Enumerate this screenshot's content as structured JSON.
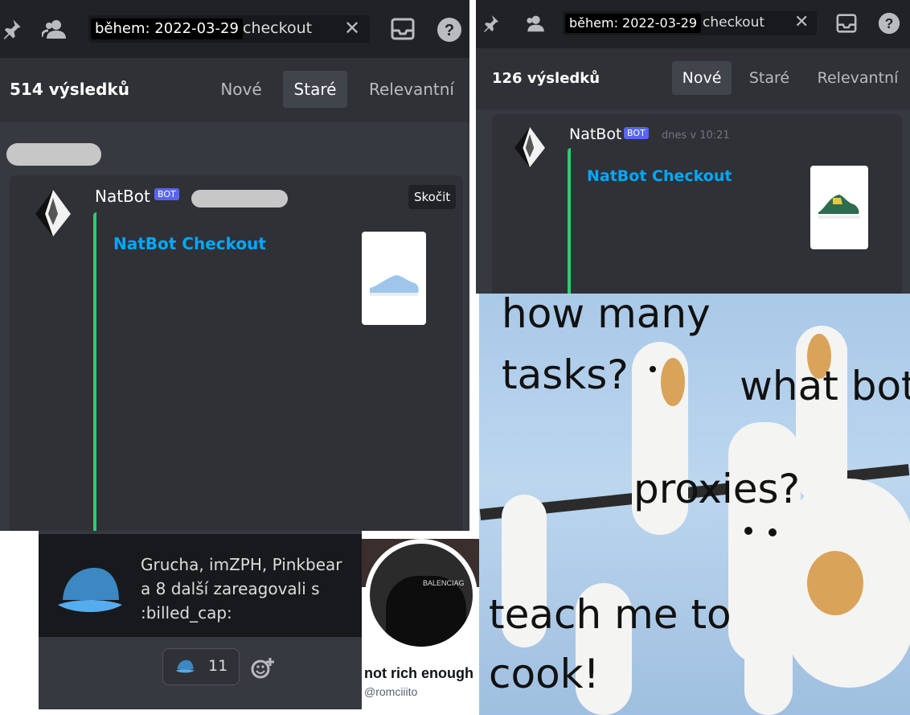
{
  "left_panel": {
    "search": {
      "chip": "během: 2022-03-29",
      "query": "checkout"
    },
    "results": {
      "count": "514 výsledků",
      "tabs": [
        "Nové",
        "Staré",
        "Relevantní"
      ],
      "active": "Staré"
    },
    "message": {
      "user": "NatBot",
      "badge": "BOT",
      "jump": "Skočit",
      "embed_title": "NatBot Checkout"
    }
  },
  "right_panel": {
    "search": {
      "chip": "během: 2022-03-29",
      "query": "checkout"
    },
    "results": {
      "count": "126 výsledků",
      "tabs": [
        "Nové",
        "Staré",
        "Relevantní"
      ],
      "active": "Nové"
    },
    "message": {
      "user": "NatBot",
      "badge": "BOT",
      "time": "dnes v 10:21",
      "embed_title": "NatBot Checkout"
    }
  },
  "tooltip": {
    "line1": "Grucha, imZPH, Pinkbear",
    "line2": "a 8 další zareagovali s",
    "line3": ":billed_cap:",
    "reaction_count": "11"
  },
  "twitter": {
    "name": "not rich enough",
    "handle": "@romciiito",
    "shirt_text": "BALENCIAG"
  },
  "meme": {
    "text1": "how many",
    "text2": "tasks?",
    "text3": "what bot",
    "text4": "proxies?",
    "text5": "teach me to",
    "text6": "cook!"
  },
  "colors": {
    "embed_bar": "#2ecc71",
    "title": "#00a8fc",
    "bot_badge": "#5865f2",
    "bg": "#36393f"
  }
}
